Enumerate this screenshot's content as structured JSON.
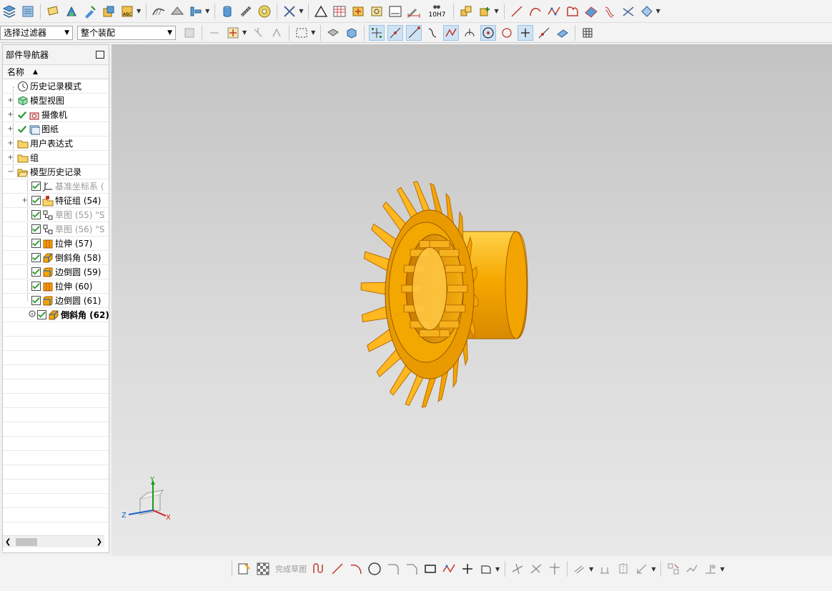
{
  "filters": {
    "selection_filter": "选择过滤器",
    "assembly_scope": "整个装配"
  },
  "navigator": {
    "title": "部件导航器",
    "column_name": "名称",
    "items": [
      {
        "label": "历史记录模式",
        "icon": "clock-icon"
      },
      {
        "label": "模型视图",
        "icon": "model-view-icon"
      },
      {
        "label": "摄像机",
        "icon": "camera-icon"
      },
      {
        "label": "图纸",
        "icon": "drawing-sheet-icon"
      },
      {
        "label": "用户表达式",
        "icon": "folder-icon"
      },
      {
        "label": "组",
        "icon": "folder-icon"
      },
      {
        "label": "模型历史记录",
        "icon": "open-folder-icon"
      },
      {
        "label": "基准坐标系 (",
        "icon": "datum-csys-icon"
      },
      {
        "label": "特征组 (54)",
        "icon": "feature-group-icon"
      },
      {
        "label": "草图 (55) \"S",
        "icon": "sketch-icon"
      },
      {
        "label": "草图 (56) \"S",
        "icon": "sketch-icon"
      },
      {
        "label": "拉伸 (57)",
        "icon": "extrude-icon"
      },
      {
        "label": "倒斜角 (58)",
        "icon": "chamfer-icon"
      },
      {
        "label": "边倒圆 (59)",
        "icon": "edge-blend-icon"
      },
      {
        "label": "拉伸 (60)",
        "icon": "extrude-icon"
      },
      {
        "label": "边倒圆 (61)",
        "icon": "edge-blend-icon"
      },
      {
        "label": "倒斜角 (62)",
        "icon": "chamfer-icon"
      }
    ]
  },
  "toolbar": {
    "finish_sketch": "完成草图",
    "tolerance_label": "10H7"
  },
  "triad": {
    "y": "Y",
    "z": "Z",
    "x": "X"
  },
  "colors": {
    "gear": "#f4a400",
    "gear_dark": "#b86f00",
    "check": "#2a9a2a",
    "accent": "#1e6fc2"
  }
}
